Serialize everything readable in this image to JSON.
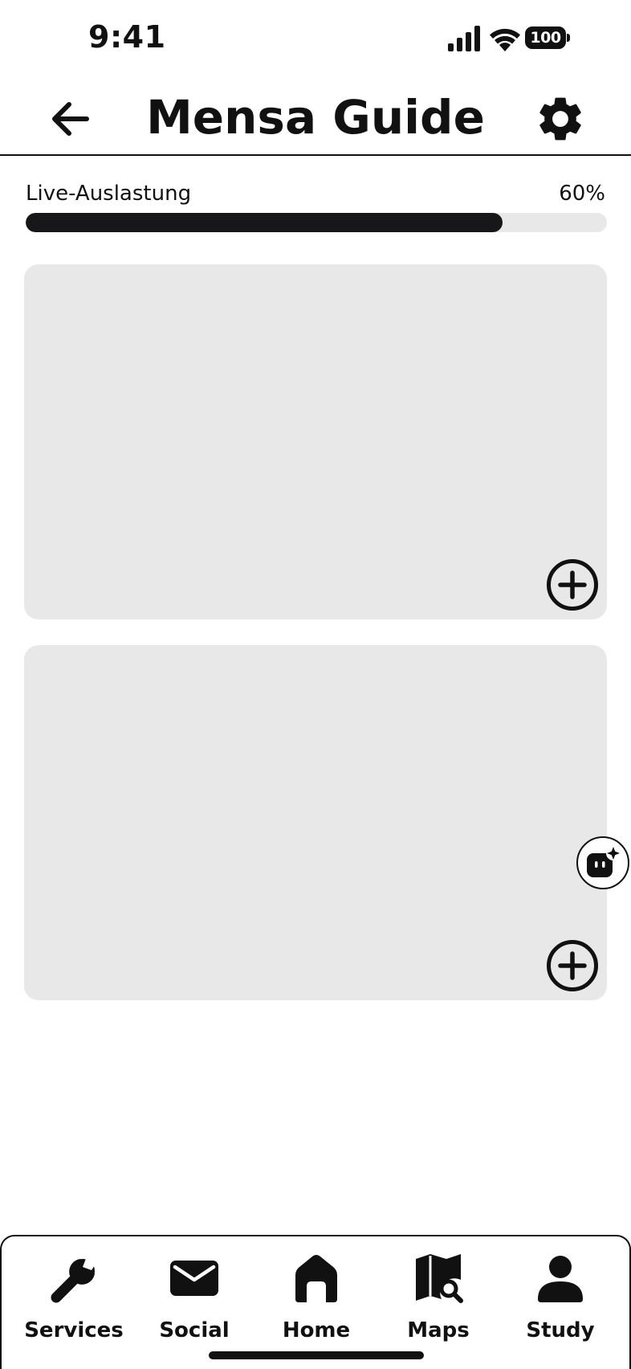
{
  "status_bar": {
    "time": "9:41",
    "battery_level": "100",
    "icons": [
      "signal-icon",
      "wifi-icon",
      "battery-icon"
    ]
  },
  "header": {
    "title": "Mensa Guide",
    "back_icon": "arrow-left-icon",
    "settings_icon": "gear-icon"
  },
  "occupancy": {
    "label": "Live-Auslastung",
    "value_text": "60%",
    "fraction": 0.82
  },
  "cards": [
    {
      "action_icon": "plus-circle-icon"
    },
    {
      "action_icon": "plus-circle-icon"
    }
  ],
  "assistant": {
    "icon": "ai-assistant-icon"
  },
  "bottom_nav": {
    "items": [
      {
        "label": "Services",
        "icon": "wrench-icon"
      },
      {
        "label": "Social",
        "icon": "envelope-icon"
      },
      {
        "label": "Home",
        "icon": "home-icon"
      },
      {
        "label": "Maps",
        "icon": "map-search-icon"
      },
      {
        "label": "Study",
        "icon": "person-icon"
      }
    ]
  },
  "colors": {
    "primary": "#111111",
    "card_background": "#e8e8e8",
    "progress_fill": "#17171a",
    "background": "#ffffff"
  }
}
